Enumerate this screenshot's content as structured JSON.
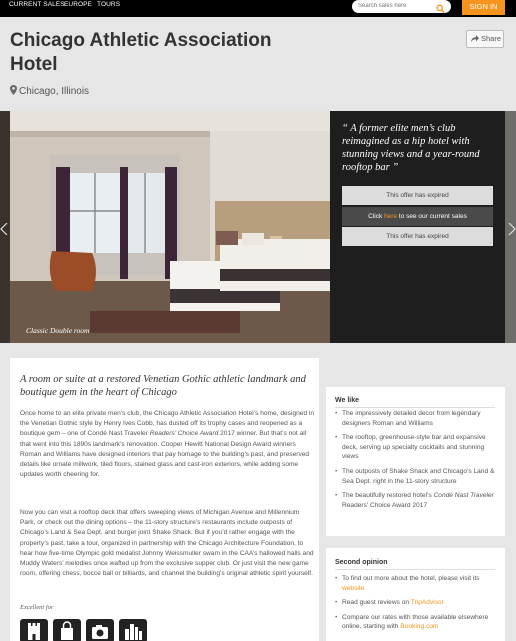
{
  "nav": {
    "links": [
      "CURRENT SALES",
      "EUROPE",
      "TOURS"
    ],
    "search_placeholder": "Search sales here",
    "signin": "SIGN IN"
  },
  "hotel": {
    "title": "Chicago Athletic Association Hotel",
    "location": "Chicago, Illinois",
    "share_label": "Share"
  },
  "hero": {
    "caption": "Classic Double room",
    "quote": "“ A former elite men’s club reimagined as a hip hotel with stunning views and a year-round rooftop bar ”",
    "offer_expired_1": "This offer has expired",
    "offer_click": "Click",
    "offer_here": "here",
    "offer_rest": "to see our current sales",
    "offer_expired_2": "This offer has expired"
  },
  "main": {
    "heading": "A room or suite at a restored Venetian Gothic athletic landmark and boutique gem in the heart of Chicago",
    "para1_a": "Once home to an elite private men’s club, the Chicago Athletic Association Hotel’s home, designed in the Venetian Gothic style by Henry Ives Cobb, has dusted off its trophy cases and reopened as a boutique gem – one of Condé Nast Traveler ",
    "para1_em": "Readers’ Choice Award",
    "para1_b": " 2017 winner. But that’s not all that went into this 1890s landmark’s renovation. Cooper Hewitt National Design Award winners Roman and Williams have designed interiors that pay homage to the building’s past, and preserved details like ornate millwork, tiled floors, stained glass and cast-iron exteriors, while adding some updates worth cheering for.",
    "para2": "Now you can visit a rooftop deck that offers sweeping views of Michigan Avenue and Millennium Park, or check out the dining options – the 11-story structure’s restaurants include outposts of Chicago’s Land & Sea Dept. and burger joint Shake Shack. But if you’d rather engage with the property’s past, take a tour, organized in partnership with the Chicago Architecture Foundation, to hear how five-time Olympic gold medalist Johnny Weissmuller swam in the CAA’s hallowed halls and Muddy Waters’ melodies once wafted up from the exclusive supper club. Or just visit the new game room, offering chess, bocce ball or billiards, and channel the building’s original athletic spirit yourself.",
    "excellent_for": "Excellent for",
    "badges": [
      "castle-icon",
      "bag-icon",
      "camera-icon",
      "city-icon"
    ]
  },
  "we_like": {
    "title": "We like",
    "items": [
      "The impressively detailed decor from legendary designers Roman and Williams",
      "The rooftop, greenhouse-style bar and expansive deck, serving up specialty cocktails and stunning views",
      "The outposts of Shake Shack and Chicago’s Land & Sea Dept. right in the 11-story structure"
    ],
    "item4_a": "The beautifully restored hotel’s ",
    "item4_em": "Condé Nast Traveler",
    "item4_b": " Readers’ Choice Award 2017"
  },
  "second_opinion": {
    "title": "Second opinion",
    "item1_text": "To find out more about the hotel, please visit its",
    "item1_link": "website",
    "item2_text": "Read guest reviews on",
    "item2_link": "TripAdvisor",
    "item3_text": "Compare our rates with those available elsewhere online, starting with",
    "item3_link": "Booking.com"
  },
  "colors": {
    "accent": "#f7941d",
    "dark": "#1e1e1e",
    "background": "#e6e6e6"
  }
}
